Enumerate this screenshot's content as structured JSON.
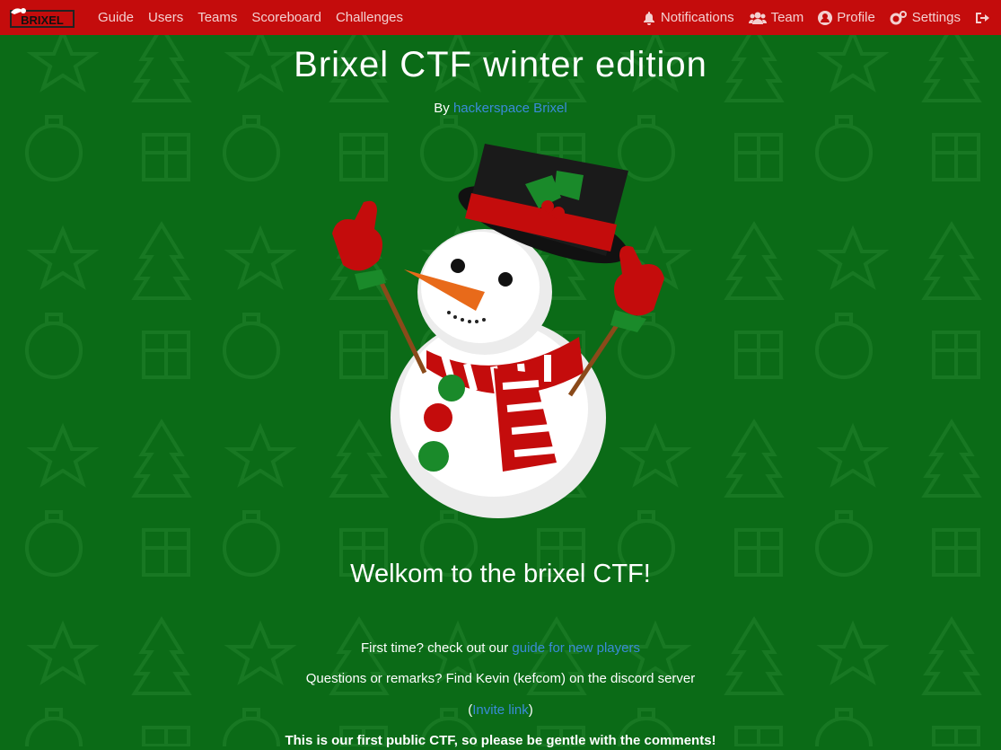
{
  "brand": {
    "logo_text": "BRIXEL"
  },
  "nav": {
    "left": [
      {
        "label": "Guide"
      },
      {
        "label": "Users"
      },
      {
        "label": "Teams"
      },
      {
        "label": "Scoreboard"
      },
      {
        "label": "Challenges"
      }
    ],
    "right": [
      {
        "label": "Notifications",
        "icon": "bell-icon"
      },
      {
        "label": "Team",
        "icon": "users-icon"
      },
      {
        "label": "Profile",
        "icon": "user-circle-icon"
      },
      {
        "label": "Settings",
        "icon": "cogs-icon"
      }
    ],
    "logout_icon": "sign-out-icon"
  },
  "page": {
    "title": "Brixel CTF winter edition",
    "by_prefix": "By",
    "by_link": "hackerspace Brixel",
    "welcome": "Welkom to the brixel CTF!",
    "first_time_prefix": "First time? check out our",
    "first_time_link": "guide for new players",
    "questions": "Questions or remarks? Find Kevin (kefcom) on the discord server",
    "invite_open": "(",
    "invite_link": "Invite link",
    "invite_close": ")",
    "notice": "This is our first public CTF, so please be gentle with the comments!"
  },
  "colors": {
    "navbar": "#c40c0c",
    "background": "#0b6b17",
    "link": "#3a8bd8"
  }
}
